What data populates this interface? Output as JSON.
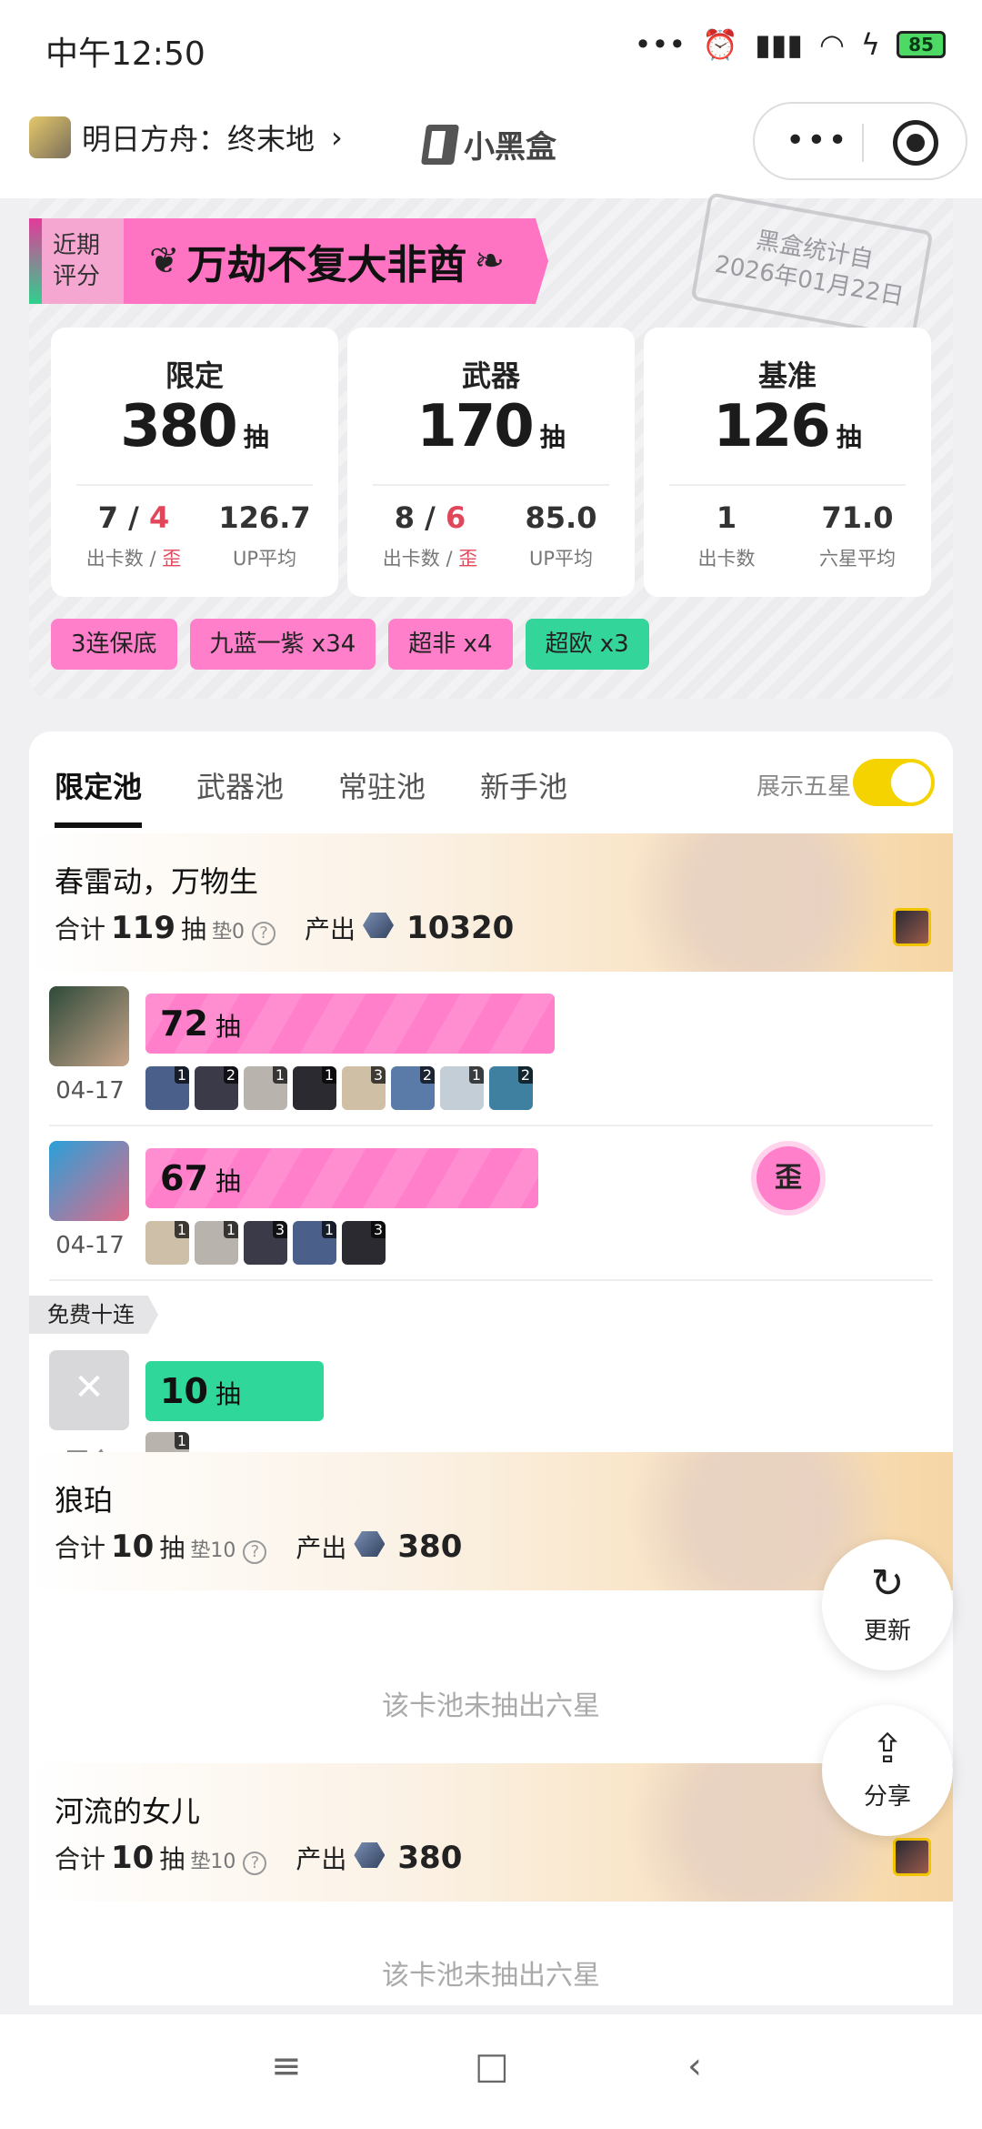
{
  "status": {
    "time": "中午12:50",
    "battery": "85"
  },
  "header": {
    "game_title": "明日方舟：终末地",
    "chevron": "›",
    "brand": "小黑盒",
    "more": "•••"
  },
  "summary": {
    "rating_label_1": "近期",
    "rating_label_2": "评分",
    "rating_title": "万劫不复大非酋",
    "laurel_left": "❦",
    "laurel_right": "❧",
    "stamp_line1": "黑盒统计自",
    "stamp_line2": "2026年01月22日",
    "stats": [
      {
        "name": "限定",
        "total": "380",
        "unit": "抽",
        "a_val": "7",
        "a_bad": "4",
        "a_label": "出卡数",
        "a_label_bad": "歪",
        "b_val": "126.7",
        "b_label": "UP平均"
      },
      {
        "name": "武器",
        "total": "170",
        "unit": "抽",
        "a_val": "8",
        "a_bad": "6",
        "a_label": "出卡数",
        "a_label_bad": "歪",
        "b_val": "85.0",
        "b_label": "UP平均"
      },
      {
        "name": "基准",
        "total": "126",
        "unit": "抽",
        "a_val": "1",
        "a_label": "出卡数",
        "b_val": "71.0",
        "b_label": "六星平均"
      }
    ],
    "tags": [
      "3连保底",
      "九蓝一紫 x34",
      "超非 x4",
      "超欧 x3"
    ]
  },
  "pool": {
    "tabs": [
      "限定池",
      "武器池",
      "常驻池",
      "新手池"
    ],
    "toggle_label": "展示五星",
    "toggle_on": true,
    "banners": [
      {
        "name": "春雷动，万物生",
        "total_label": "合计",
        "total": "119",
        "unit": "抽",
        "pad": "垫0",
        "produce_label": "产出",
        "produce": "10320"
      },
      {
        "name": "狼珀",
        "total_label": "合计",
        "total": "10",
        "unit": "抽",
        "pad": "垫10",
        "produce_label": "产出",
        "produce": "380"
      },
      {
        "name": "河流的女儿",
        "total_label": "合计",
        "total": "10",
        "unit": "抽",
        "pad": "垫10",
        "produce_label": "产出",
        "produce": "380"
      }
    ],
    "rows": [
      {
        "count": "72",
        "unit": "抽",
        "date": "04-17",
        "minis": [
          "1",
          "2",
          "1",
          "1",
          "3",
          "2",
          "1",
          "2"
        ]
      },
      {
        "count": "67",
        "unit": "抽",
        "date": "04-17",
        "badge": "歪",
        "minis": [
          "1",
          "1",
          "3",
          "1",
          "3"
        ]
      }
    ],
    "free_tag": "免费十连",
    "free_row": {
      "count": "10",
      "unit": "抽",
      "date": "至今",
      "minis": [
        "1"
      ]
    },
    "no_six": "该卡池未抽出六星",
    "help": "?"
  },
  "float": {
    "refresh": "更新",
    "refresh_icon": "↻",
    "share": "分享",
    "share_icon": "⇪"
  },
  "nav": {
    "menu": "≡",
    "home": "□",
    "back": "‹"
  }
}
